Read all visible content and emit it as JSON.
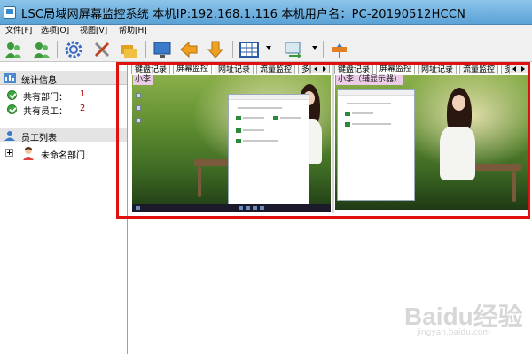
{
  "window": {
    "title": "LSC局域网屏幕监控系统    本机IP:192.168.1.116    本机用户名：PC-20190512HCCN"
  },
  "menu": {
    "items": [
      "文件[F]",
      "选项[O]",
      "视图[V]",
      "帮助[H]"
    ]
  },
  "toolbar": {
    "buttons": [
      "add-users-icon",
      "remove-users-icon",
      "settings-gear-icon",
      "tools-icon",
      "clients-icon",
      "monitor-icon",
      "arrow-left-icon",
      "arrow-down-icon",
      "grid-view-icon",
      "transfer-icon",
      "sign-icon"
    ]
  },
  "sidebar": {
    "stats_title": "统计信息",
    "stats": [
      {
        "label": "共有部门：",
        "value": "1"
      },
      {
        "label": "共有员工：",
        "value": "2"
      }
    ],
    "employees_title": "员工列表",
    "tree": [
      {
        "label": "未命名部门"
      }
    ]
  },
  "panes": [
    {
      "tabs": [
        "键盘记录",
        "屏幕监控",
        "网址记录",
        "流量监控",
        "多"
      ],
      "active_tab": "屏幕监控",
      "screen_label": "小李"
    },
    {
      "tabs": [
        "键盘记录",
        "屏幕监控",
        "网址记录",
        "流量监控",
        "多"
      ],
      "active_tab": "屏幕监控",
      "screen_label": "小李（辅显示器）"
    }
  ],
  "watermark": {
    "text": "Baidu经验",
    "sub": "jingyan.baidu.com"
  },
  "colors": {
    "highlight": "#e01010",
    "titlebar": "#6aaedc",
    "stat_value": "#b00000",
    "label_bg": "#eccbe8"
  }
}
